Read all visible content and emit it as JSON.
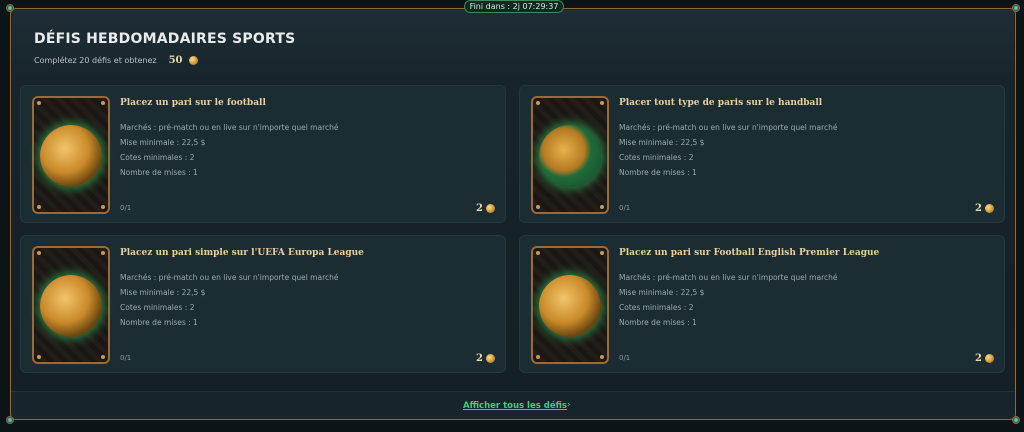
{
  "header": {
    "timer_label": "Fini dans : 2j 07:29:37",
    "title": "DÉFIS HEBDOMADAIRES SPORTS",
    "subtitle": "Complétez 20 défis et obtenez",
    "subtitle_amount": "50"
  },
  "cards": [
    {
      "title": "Placez un pari sur le football",
      "markets": "Marchés : pré-match ou en live sur n'importe quel marché",
      "min_stake": "Mise minimale : 22,5 $",
      "min_odds": "Cotes minimales : 2",
      "bets_count": "Nombre de mises : 1",
      "progress": "0/1",
      "reward": "2",
      "art_icon": "football-icon"
    },
    {
      "title": "Placer tout type de paris sur le handball",
      "markets": "Marchés : pré-match ou en live sur n'importe quel marché",
      "min_stake": "Mise minimale : 22,5 $",
      "min_odds": "Cotes minimales : 2",
      "bets_count": "Nombre de mises : 1",
      "progress": "0/1",
      "reward": "2",
      "art_icon": "handball-icon"
    },
    {
      "title": "Placez un pari simple sur l'UEFA Europa League",
      "markets": "Marchés : pré-match ou en live sur n'importe quel marché",
      "min_stake": "Mise minimale : 22,5 $",
      "min_odds": "Cotes minimales : 2",
      "bets_count": "Nombre de mises : 1",
      "progress": "0/1",
      "reward": "2",
      "art_icon": "football-icon"
    },
    {
      "title": "Placez un pari sur Football English Premier League",
      "markets": "Marchés : pré-match ou en live sur n'importe quel marché",
      "min_stake": "Mise minimale : 22,5 $",
      "min_odds": "Cotes minimales : 2",
      "bets_count": "Nombre de mises : 1",
      "progress": "0/1",
      "reward": "2",
      "art_icon": "football-icon"
    }
  ],
  "footer": {
    "link_label": "Afficher tous les défis",
    "chevron": "›"
  },
  "colors": {
    "accent_green": "#3fd07a",
    "gold_text": "#e6cfa0",
    "card_bg": "#1c2c33",
    "frame_border": "#8a6a3e"
  }
}
